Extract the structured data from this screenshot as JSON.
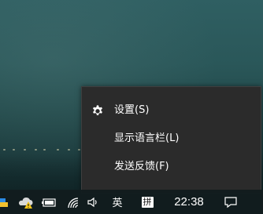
{
  "menu": {
    "items": [
      {
        "label": "设置(S)",
        "icon": "gear-icon"
      },
      {
        "label": "显示语言栏(L)"
      },
      {
        "label": "发送反馈(F)"
      }
    ]
  },
  "taskbar": {
    "input_mode": "英",
    "ime_name": "拼",
    "clock": "22:38",
    "tray_icons": [
      "app-tray-icon",
      "cloud-warning-icon",
      "battery-icon",
      "wifi-icon",
      "speaker-icon",
      "notification-icon"
    ]
  }
}
